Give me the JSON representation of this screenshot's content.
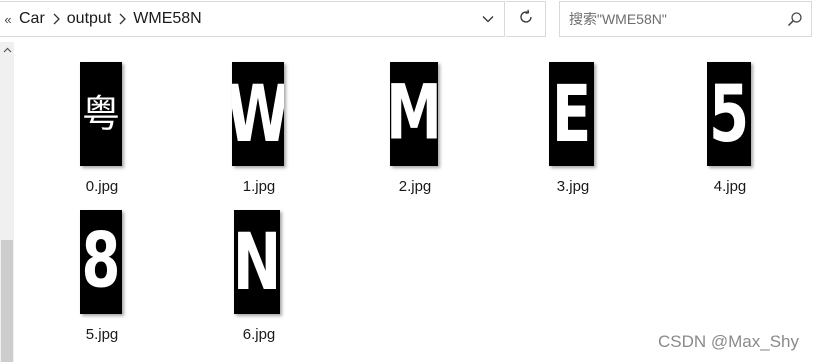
{
  "address_bar": {
    "overflow_chevron": "«",
    "breadcrumbs": [
      "Car",
      "output",
      "WME58N"
    ]
  },
  "search": {
    "placeholder": "搜索\"WME58N\""
  },
  "files": [
    {
      "name": "0.jpg",
      "thumb_char": "粤"
    },
    {
      "name": "1.jpg",
      "thumb_char": "W"
    },
    {
      "name": "2.jpg",
      "thumb_char": "M"
    },
    {
      "name": "3.jpg",
      "thumb_char": "E"
    },
    {
      "name": "4.jpg",
      "thumb_char": "5"
    },
    {
      "name": "5.jpg",
      "thumb_char": "8"
    },
    {
      "name": "6.jpg",
      "thumb_char": "N"
    }
  ],
  "watermark": "CSDN @Max_Shy",
  "icons": {
    "refresh": "refresh-icon",
    "search": "search-icon",
    "dropdown": "chevron-down-icon",
    "breadcrumb_separator": "chevron-right-icon",
    "scroll_up": "chevron-up-icon"
  }
}
